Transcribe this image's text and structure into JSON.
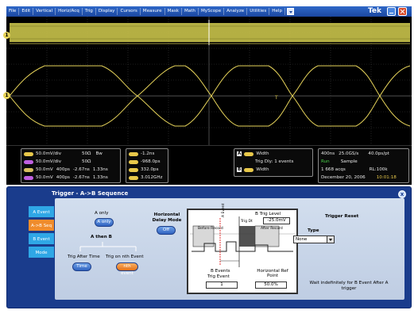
{
  "menu": {
    "items": [
      "File",
      "Edit",
      "Vertical",
      "Horiz/Acq",
      "Trig",
      "Display",
      "Cursors",
      "Measure",
      "Mask",
      "Math",
      "MyScope",
      "Analyze",
      "Utilities",
      "Help"
    ],
    "brand": "Tek"
  },
  "scope": {
    "channel1_marker": "1",
    "channel2_marker": "1",
    "colors": {
      "trace": "#e6d35a",
      "grid": "#3a3a3a",
      "background": "#000000"
    }
  },
  "readouts": {
    "ch1": {
      "scale": "50.0mV/div",
      "coupling": "50Ω",
      "bw": "Bw"
    },
    "ch2": {
      "scale": "50.0mV/div",
      "coupling": "50Ω"
    },
    "ref1": {
      "value": "50.0mV",
      "pos": "400ps",
      "delay": "-2.67ns",
      "extra": "1.33ns"
    },
    "ref2": {
      "value": "50.0mV",
      "pos": "400ps",
      "delay": "-2.67ns",
      "extra": "1.33ns"
    },
    "meas": [
      "-1.2ns",
      "-968.0ps",
      "332.0ps",
      "3.012GHz"
    ],
    "trigger_a": "Width",
    "trig_dly": "Trig Dly: 1 events",
    "trigger_b": "Width",
    "timebase": "400ns",
    "sample_rate": "25.0GS/s",
    "res": "40.0ps/pt",
    "run_state": "Run",
    "acq_mode": "Sample",
    "acqs": "1 668 acqs",
    "record_length": "RL:100k",
    "date": "December 20, 2006",
    "time": "10:01:18"
  },
  "panel": {
    "title": "Trigger - A->B Sequence",
    "close": "x",
    "tabs": [
      {
        "label": "A Event",
        "active": false
      },
      {
        "label": "A->B Seq",
        "active": true
      },
      {
        "label": "B Event",
        "active": false
      },
      {
        "label": "Mode",
        "active": false
      }
    ],
    "a_only_label": "A only",
    "a_only_button": "A only",
    "a_then_b_label": "A then B",
    "trig_after_time_label": "Trig After Time",
    "time_button": "Time",
    "trig_on_nth_label": "Trig on nth Event",
    "nth_event_button": "nth event",
    "horizontal_delay_label": "Horizontal Delay Mode",
    "off_button": "Off",
    "diagram": {
      "b_trig_level": "B Trig Level",
      "level_value": "-25.0mV",
      "b_event_label": "B Events",
      "trig_event_label": "Trig Event",
      "event_value": "1",
      "horizontal_label": "Horizontal Ref Point",
      "ref_value": "50.0%",
      "before_box": "Before Record",
      "after_box": "After Record",
      "a_event": "A Event",
      "trig_ot": "Trig Dt"
    },
    "trigger_reset_label": "Trigger Reset",
    "type_label": "Type",
    "type_value": "None",
    "wait_text": "Wait indefinitely for B Event After A trigger"
  }
}
